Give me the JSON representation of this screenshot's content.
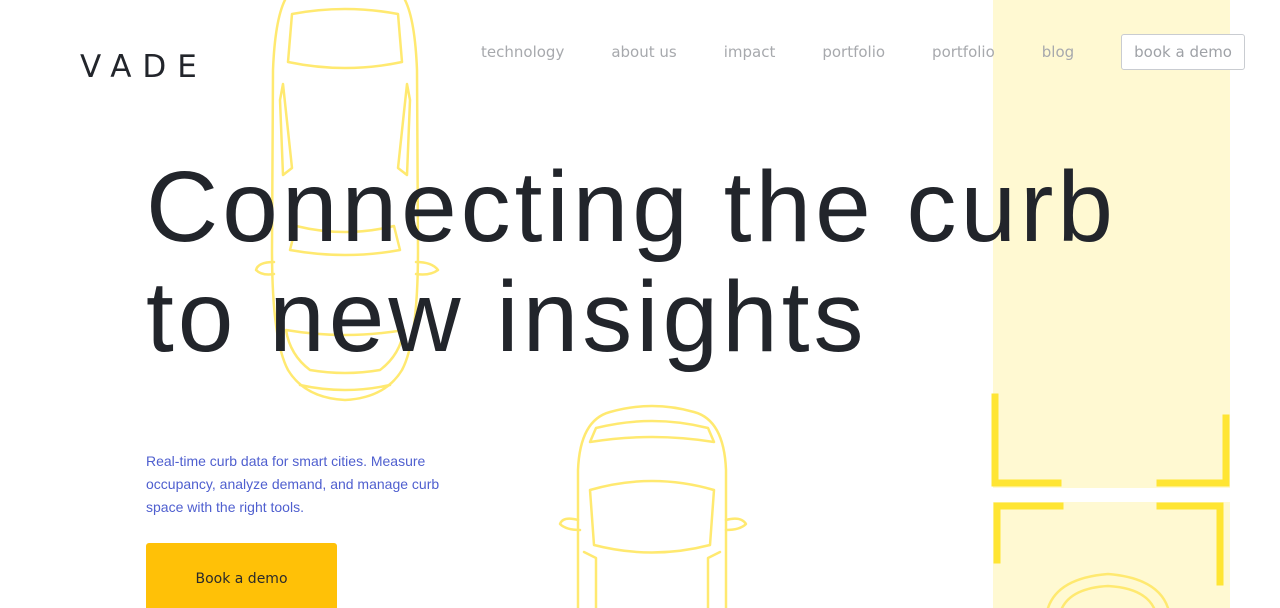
{
  "header": {
    "logo_text": "VADE"
  },
  "nav": {
    "items": [
      {
        "label": "technology"
      },
      {
        "label": "about us"
      },
      {
        "label": "impact"
      },
      {
        "label": "portfolio"
      },
      {
        "label": "portfolio"
      },
      {
        "label": "blog"
      }
    ],
    "cta_label": "book a demo"
  },
  "hero": {
    "headline_line1": "Connecting the curb",
    "headline_line2": "to new insights",
    "subtext": "Real-time curb data for smart cities. Measure occupancy, analyze demand, and manage curb space with the right tools.",
    "cta_label": "Book a demo"
  },
  "colors": {
    "accent": "#ffc107",
    "car_outline": "#ffe970",
    "highlight_strip": "#fff9d2",
    "corner_brackets": "#ffe533",
    "text_dark": "#22252b",
    "subtext": "#4f5fcf"
  }
}
